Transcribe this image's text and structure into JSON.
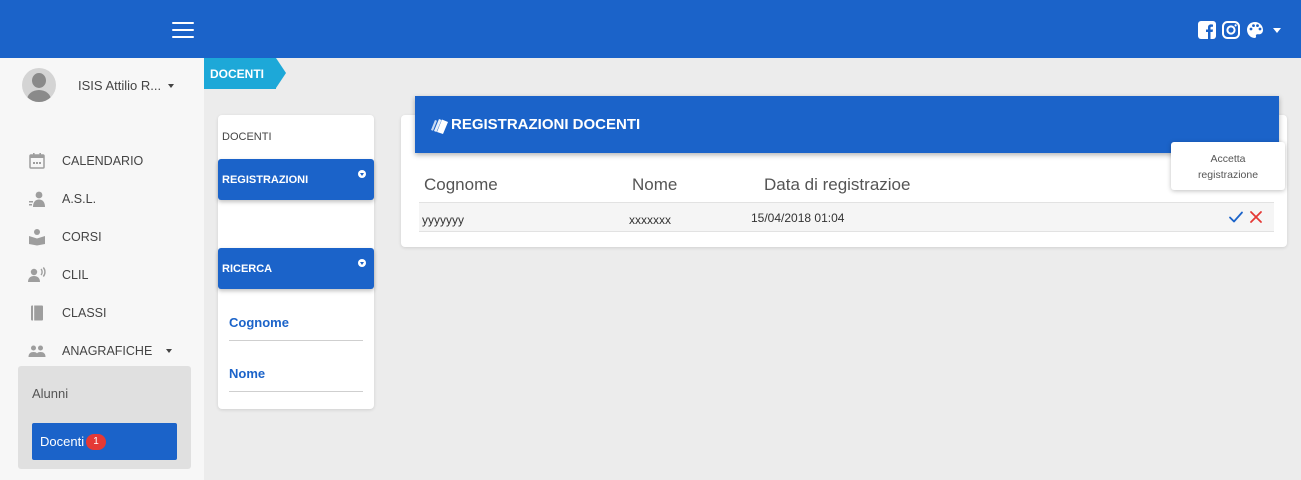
{
  "topbar": {
    "icons": [
      "facebook-icon",
      "instagram-icon",
      "palette-icon",
      "caret-down-icon"
    ]
  },
  "user": {
    "name": "ISIS Attilio R..."
  },
  "nav": {
    "items": [
      {
        "label": "CALENDARIO",
        "icon": "calendar-icon"
      },
      {
        "label": "A.S.L.",
        "icon": "teacher-icon"
      },
      {
        "label": "CORSI",
        "icon": "book-reader-icon"
      },
      {
        "label": "CLIL",
        "icon": "speaker-icon"
      },
      {
        "label": "CLASSI",
        "icon": "notebook-icon"
      },
      {
        "label": "ANAGRAFICHE",
        "icon": "people-icon"
      }
    ],
    "sub_items": [
      {
        "label": "Alunni"
      },
      {
        "label": "Docenti",
        "badge": "1"
      }
    ]
  },
  "breadcrumb": {
    "label": "DOCENTI"
  },
  "left_panel": {
    "title": "DOCENTI",
    "registrazioni_label": "REGISTRAZIONI",
    "ricerca_label": "RICERCA",
    "fields": [
      "Cognome",
      "Nome"
    ]
  },
  "main": {
    "title": "REGISTRAZIONI DOCENTI",
    "columns": [
      "Cognome",
      "Nome",
      "Data di registrazioe"
    ],
    "rows": [
      {
        "cognome": "yyyyyyy",
        "nome": "xxxxxxx",
        "data": "15/04/2018 01:04"
      }
    ],
    "tooltip": {
      "line1": "Accetta",
      "line2": "registrazione"
    }
  },
  "colors": {
    "primary": "#1b63c9",
    "breadcrumb": "#1da8d8",
    "badge": "#e53935",
    "reject": "#e53935",
    "background": "#ececec"
  }
}
